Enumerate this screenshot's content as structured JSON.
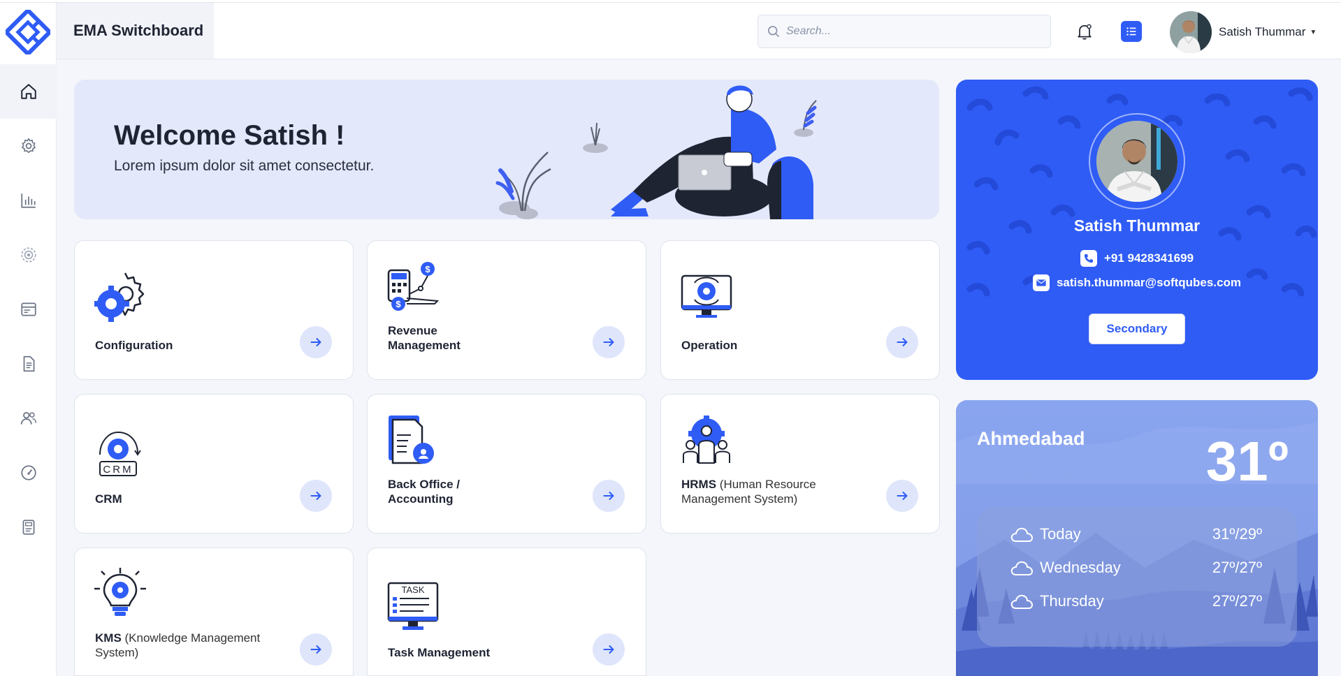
{
  "app": {
    "title": "EMA Switchboard"
  },
  "search": {
    "placeholder": "Search..."
  },
  "user": {
    "name": "Satish Thummar"
  },
  "sidebar": {
    "items": [
      {
        "name": "home",
        "icon": "home-icon"
      },
      {
        "name": "settings",
        "icon": "gear-icon"
      },
      {
        "name": "analytics",
        "icon": "bar-chart-icon"
      },
      {
        "name": "target",
        "icon": "target-gear-icon"
      },
      {
        "name": "window",
        "icon": "browser-window-icon"
      },
      {
        "name": "document",
        "icon": "document-icon"
      },
      {
        "name": "users",
        "icon": "users-icon"
      },
      {
        "name": "dashboard",
        "icon": "speedometer-icon"
      },
      {
        "name": "report",
        "icon": "report-icon"
      }
    ]
  },
  "welcome": {
    "title": "Welcome Satish !",
    "subtitle": "Lorem ipsum dolor sit amet consectetur."
  },
  "cards": [
    {
      "id": "configuration",
      "bold": "Configuration",
      "light": ""
    },
    {
      "id": "revenue",
      "bold": "Revenue Management",
      "light": ""
    },
    {
      "id": "operation",
      "bold": "Operation",
      "light": ""
    },
    {
      "id": "crm",
      "bold": "CRM",
      "light": ""
    },
    {
      "id": "backoffice",
      "bold": "Back Office / Accounting",
      "light": ""
    },
    {
      "id": "hrms",
      "bold": "HRMS",
      "light": " (Human Resource Management System)"
    },
    {
      "id": "kms",
      "bold": "KMS",
      "light": " (Knowledge Management System)"
    },
    {
      "id": "task",
      "bold": "Task Management",
      "light": ""
    }
  ],
  "crm_icon_text": "CRM",
  "task_icon_text": "TASK",
  "profile": {
    "name": "Satish Thummar",
    "phone": "+91 9428341699",
    "email": "satish.thummar@softqubes.com",
    "button_label": "Secondary"
  },
  "weather": {
    "city": "Ahmedabad",
    "temperature": "31º",
    "forecast": [
      {
        "day": "Today",
        "range": "31º/29º"
      },
      {
        "day": "Wednesday",
        "range": "27º/27º"
      },
      {
        "day": "Thursday",
        "range": "27º/27º"
      }
    ]
  },
  "colors": {
    "primary": "#2f5cf5",
    "banner_bg": "#e4e8fb",
    "arrow_bg": "#dfe6fb"
  }
}
